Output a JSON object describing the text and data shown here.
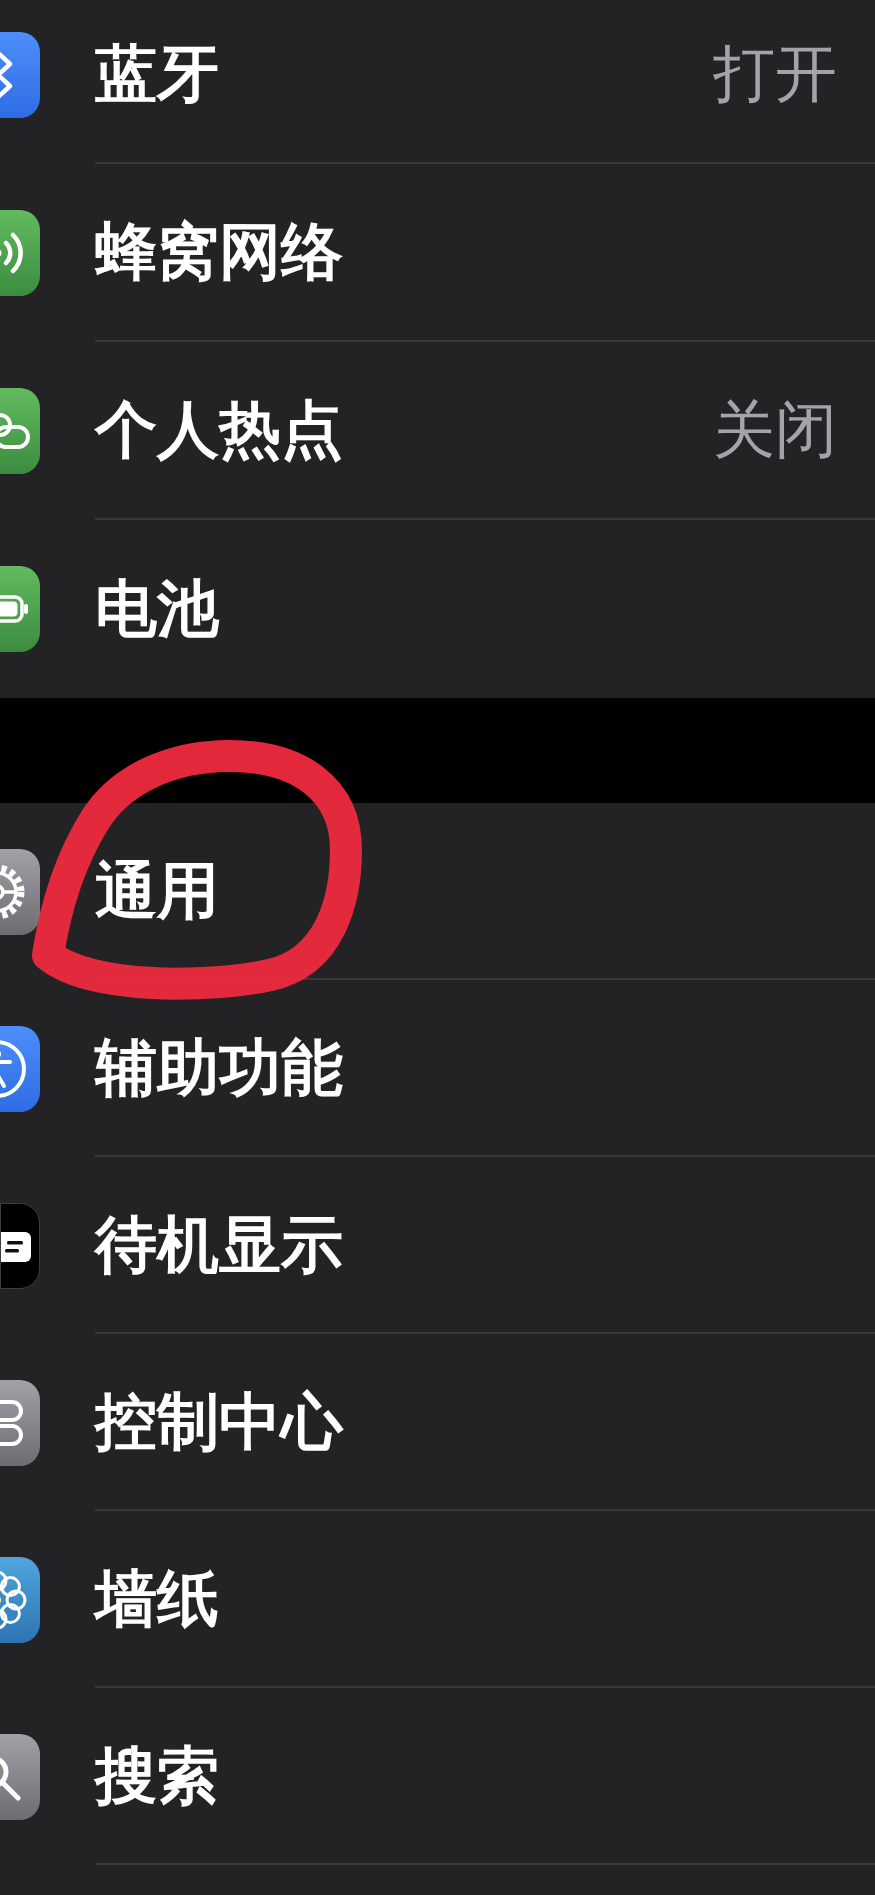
{
  "sections": [
    {
      "items": [
        {
          "label": "蓝牙",
          "value": "打开",
          "circled": false
        },
        {
          "label": "蜂窝网络",
          "circled": false
        },
        {
          "label": "个人热点",
          "value": "关闭",
          "circled": false
        },
        {
          "label": "电池",
          "circled": false
        }
      ]
    },
    {
      "items": [
        {
          "label": "通用",
          "circled": true
        },
        {
          "label": "辅助功能",
          "circled": false
        },
        {
          "label": "待机显示",
          "circled": false
        },
        {
          "label": "控制中心",
          "circled": false
        },
        {
          "label": "墙纸",
          "circled": false
        },
        {
          "label": "搜索",
          "circled": false
        }
      ]
    }
  ]
}
